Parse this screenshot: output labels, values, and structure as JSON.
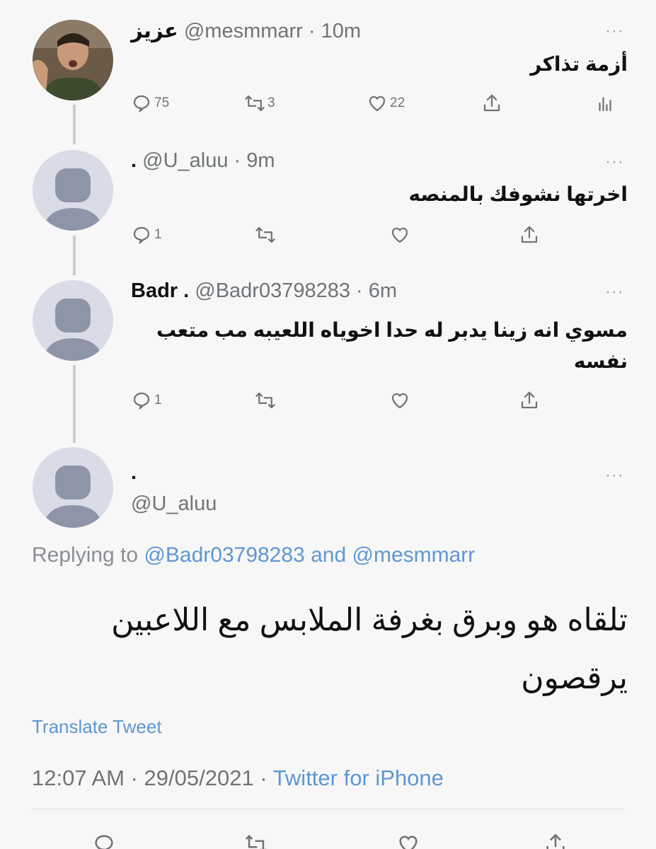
{
  "tweets": [
    {
      "display_name": "عزيز",
      "handle": "@mesmmarr",
      "time": "· 10m",
      "text": "أزمة تذاكر",
      "replies": "75",
      "retweets": "3",
      "likes": "22",
      "more": "···"
    },
    {
      "display_name": ".",
      "handle": "@U_aluu",
      "time": "· 9m",
      "text": "اخرتها نشوفك بالمنصه",
      "replies": "1",
      "more": "···"
    },
    {
      "display_name": "Badr .",
      "handle": "@Badr03798283",
      "time": "· 6m",
      "text_line1": "مسوي انه زينا يدبر له حدا اخوياه اللعيبه مب متعب",
      "text_line2": "نفسه",
      "replies": "1",
      "more": "···"
    }
  ],
  "main_tweet": {
    "display_name": ".",
    "handle": "@U_aluu",
    "more": "···",
    "replying_prefix": "Replying to",
    "replying_user1": "@Badr03798283",
    "replying_and": "and",
    "replying_user2": "@mesmmarr",
    "text_line1": "تلقاه هو وبرق بغرفة الملابس مع اللاعبين",
    "text_line2": "يرقصون",
    "translate_label": "Translate Tweet",
    "timestamp": "12:07 AM · 29/05/2021 ·",
    "source": "Twitter for iPhone"
  },
  "colors": {
    "background": "#f7f7f7",
    "link": "#5f97d0",
    "muted": "#6f7478",
    "default_avatar": "#d9dbe6"
  },
  "icons": [
    "reply-icon",
    "retweet-icon",
    "like-icon",
    "share-icon",
    "analytics-icon",
    "more-icon",
    "default-avatar-icon"
  ]
}
